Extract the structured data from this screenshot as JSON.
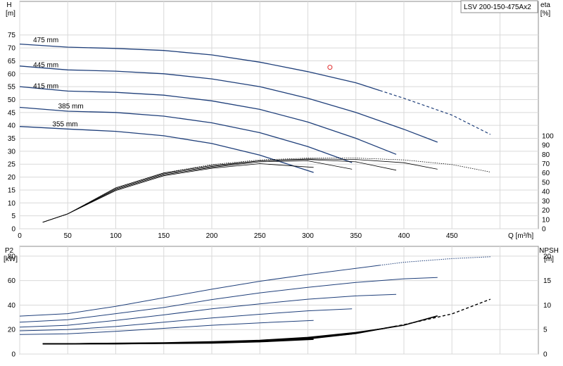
{
  "model_label": "LSV 200-150-475Ax2",
  "top": {
    "left_axis_label": "H",
    "left_axis_unit": "[m]",
    "right_axis_label": "eta",
    "right_axis_unit": "[%]",
    "x_axis_label": "Q [m³/h]"
  },
  "bottom": {
    "left_axis_label": "P2",
    "left_axis_unit": "[kW]",
    "right_axis_label": "NPSH",
    "right_axis_unit": "[m]"
  },
  "colors": {
    "head_curve": "#1f3f7a",
    "eta_curve": "#000000",
    "power_curve": "#1f3f7a",
    "npsh_curve": "#000000",
    "duty_point": "#e03030",
    "grid": "#d9d9d9"
  },
  "chart_data": [
    {
      "type": "line",
      "title": "",
      "xlabel": "Q [m³/h]",
      "ylabel": "H [m]",
      "y2label": "eta [%]",
      "xlim": [
        0,
        540
      ],
      "ylim": [
        0,
        88
      ],
      "y2lim": [
        0,
        1.5
      ],
      "x_ticks": [
        0,
        50,
        100,
        150,
        200,
        250,
        300,
        350,
        400,
        450
      ],
      "y_ticks": [
        0,
        5,
        10,
        15,
        20,
        25,
        30,
        35,
        40,
        45,
        50,
        55,
        60,
        65,
        70,
        75
      ],
      "y2_ticks": [
        0,
        10,
        20,
        30,
        40,
        50,
        60,
        70,
        80,
        90,
        100
      ],
      "grid": true,
      "head_series": [
        {
          "name": "475 mm",
          "x": [
            0,
            50,
            100,
            150,
            200,
            250,
            300,
            350,
            375
          ],
          "y": [
            71.5,
            70.3,
            69.8,
            69,
            67.3,
            64.5,
            60.8,
            56.5,
            53.5
          ],
          "dashed_x": [
            375,
            400,
            450,
            490
          ],
          "dashed_y": [
            53.5,
            50.5,
            44,
            36.5
          ]
        },
        {
          "name": "445 mm",
          "x": [
            0,
            50,
            100,
            150,
            200,
            250,
            300,
            350,
            400,
            435
          ],
          "y": [
            63,
            61.5,
            61,
            60,
            58,
            55,
            50.5,
            45,
            38.5,
            33.5
          ]
        },
        {
          "name": "415 mm",
          "x": [
            0,
            50,
            100,
            150,
            200,
            250,
            300,
            350,
            392
          ],
          "y": [
            55,
            53.3,
            52.8,
            51.7,
            49.5,
            46.2,
            41.3,
            35,
            28.8
          ]
        },
        {
          "name": "385 mm",
          "x": [
            0,
            50,
            100,
            150,
            200,
            250,
            300,
            346
          ],
          "y": [
            47,
            45.5,
            45,
            43.6,
            41,
            37.2,
            31.8,
            25.6
          ]
        },
        {
          "name": "355 mm",
          "x": [
            0,
            50,
            100,
            150,
            200,
            250,
            306
          ],
          "y": [
            39.6,
            38.6,
            37.7,
            36,
            33,
            28.5,
            21.8
          ]
        }
      ],
      "efficiency_series": [
        {
          "end": 490,
          "x": [
            24,
            50,
            100,
            150,
            200,
            250,
            300,
            350,
            400,
            450,
            490
          ],
          "y": [
            7,
            16,
            44,
            60,
            69,
            74,
            76,
            76,
            74,
            69,
            61
          ]
        },
        {
          "end": 435,
          "x": [
            24,
            50,
            100,
            150,
            200,
            250,
            300,
            350,
            400,
            435
          ],
          "y": [
            7,
            16,
            44,
            60,
            68,
            73,
            75,
            74.5,
            71,
            64
          ]
        },
        {
          "end": 392,
          "x": [
            24,
            50,
            100,
            150,
            200,
            250,
            300,
            350,
            392
          ],
          "y": [
            7,
            16,
            43,
            59,
            67,
            73,
            74.5,
            72,
            63
          ]
        },
        {
          "end": 346,
          "x": [
            24,
            50,
            100,
            150,
            200,
            250,
            300,
            346
          ],
          "y": [
            7,
            16,
            42,
            58,
            66,
            72,
            73,
            64
          ]
        },
        {
          "end": 306,
          "x": [
            24,
            50,
            100,
            150,
            200,
            250,
            306
          ],
          "y": [
            7,
            16,
            41,
            57,
            65,
            70,
            66
          ]
        }
      ],
      "duty_point": {
        "x": 323,
        "y": 62.5
      },
      "line_labels": [
        "475 mm",
        "445 mm",
        "415 mm",
        "385 mm",
        "355 mm"
      ]
    },
    {
      "type": "line",
      "title": "",
      "xlabel": "",
      "ylabel": "P2 [kW]",
      "y2label": "NPSH [m]",
      "xlim": [
        0,
        540
      ],
      "ylim": [
        0,
        88
      ],
      "y2lim": [
        0,
        22
      ],
      "y_ticks": [
        0,
        20,
        40,
        60,
        80
      ],
      "y2_ticks": [
        0,
        5,
        10,
        15,
        20
      ],
      "grid": true,
      "power_series": [
        {
          "x": [
            0,
            50,
            100,
            150,
            200,
            250,
            300,
            350,
            375
          ],
          "y": [
            31,
            33,
            39,
            46,
            53,
            59.5,
            65,
            70,
            72.5
          ],
          "dashed_x": [
            375,
            400,
            450,
            490
          ],
          "dashed_y": [
            72.5,
            75,
            78,
            79.5
          ]
        },
        {
          "x": [
            0,
            50,
            100,
            150,
            200,
            250,
            300,
            350,
            400,
            435
          ],
          "y": [
            26,
            28,
            33,
            38,
            44.5,
            50,
            54.5,
            58.5,
            61.5,
            62.5
          ]
        },
        {
          "x": [
            0,
            50,
            100,
            150,
            200,
            250,
            300,
            350,
            392
          ],
          "y": [
            22,
            23.5,
            27.5,
            32,
            37,
            41,
            44.8,
            47.5,
            48.8
          ]
        },
        {
          "x": [
            0,
            50,
            100,
            150,
            200,
            250,
            300,
            346
          ],
          "y": [
            19,
            20,
            22.5,
            26,
            29.5,
            32.5,
            35.3,
            37
          ]
        },
        {
          "x": [
            0,
            50,
            100,
            150,
            200,
            250,
            306
          ],
          "y": [
            16,
            16.5,
            18.5,
            21,
            23.5,
            25.5,
            27.5
          ]
        }
      ],
      "npsh_series": [
        {
          "x": [
            24,
            50,
            100,
            150,
            200,
            250,
            300,
            350,
            375
          ],
          "y": [
            2.1,
            2.1,
            2.2,
            2.3,
            2.5,
            2.8,
            3.4,
            4.4,
            5.1
          ],
          "dashed_x": [
            375,
            400,
            450,
            490
          ],
          "dashed_y": [
            5.1,
            6,
            8.2,
            11.2
          ]
        },
        {
          "x": [
            24,
            50,
            100,
            150,
            200,
            250,
            300,
            350,
            400,
            435
          ],
          "y": [
            2.1,
            2.1,
            2.15,
            2.25,
            2.4,
            2.7,
            3.3,
            4.3,
            5.9,
            7.8
          ]
        },
        {
          "x": [
            24,
            50,
            100,
            150,
            200,
            250,
            300,
            350,
            392
          ],
          "y": [
            2.1,
            2.1,
            2.15,
            2.2,
            2.35,
            2.6,
            3.2,
            4.2,
            5.7
          ]
        },
        {
          "x": [
            24,
            50,
            100,
            150,
            200,
            250,
            300,
            346
          ],
          "y": [
            2.1,
            2.1,
            2.1,
            2.2,
            2.3,
            2.55,
            3.1,
            4.1
          ]
        },
        {
          "x": [
            24,
            50,
            100,
            150,
            200,
            250,
            306
          ],
          "y": [
            2.1,
            2.1,
            2.1,
            2.15,
            2.25,
            2.5,
            3.0
          ]
        }
      ]
    }
  ]
}
